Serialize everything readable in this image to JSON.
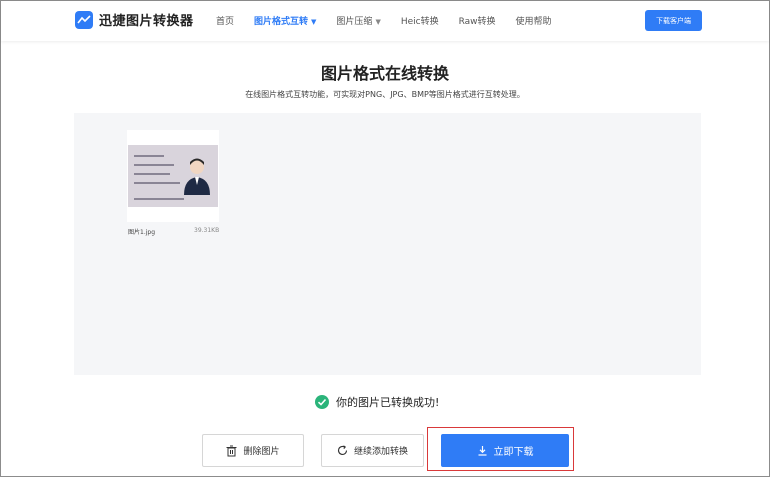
{
  "header": {
    "logo_text": "迅捷图片转换器",
    "nav": [
      {
        "label": "首页",
        "active": false,
        "dropdown": false
      },
      {
        "label": "图片格式互转",
        "active": true,
        "dropdown": true
      },
      {
        "label": "图片压缩",
        "active": false,
        "dropdown": true
      },
      {
        "label": "Heic转换",
        "active": false,
        "dropdown": false
      },
      {
        "label": "Raw转换",
        "active": false,
        "dropdown": false
      },
      {
        "label": "使用帮助",
        "active": false,
        "dropdown": false
      }
    ],
    "download_client_label": "下载客户端"
  },
  "main": {
    "title": "图片格式在线转换",
    "subtitle": "在线图片格式互转功能，可实现对PNG、JPG、BMP等图片格式进行互转处理。"
  },
  "file": {
    "name": "图片1.jpg",
    "size": "39.31KB"
  },
  "status": {
    "message": "你的图片已转换成功!"
  },
  "actions": {
    "delete_label": "删除图片",
    "add_label": "继续添加转换",
    "download_label": "立即下载"
  },
  "colors": {
    "accent": "#2f7cf6",
    "success": "#2bb47a",
    "highlight": "#d9393a"
  },
  "icons": [
    "logo-icon",
    "chevron-down-icon",
    "check-circle-icon",
    "trash-icon",
    "refresh-icon",
    "download-icon"
  ]
}
